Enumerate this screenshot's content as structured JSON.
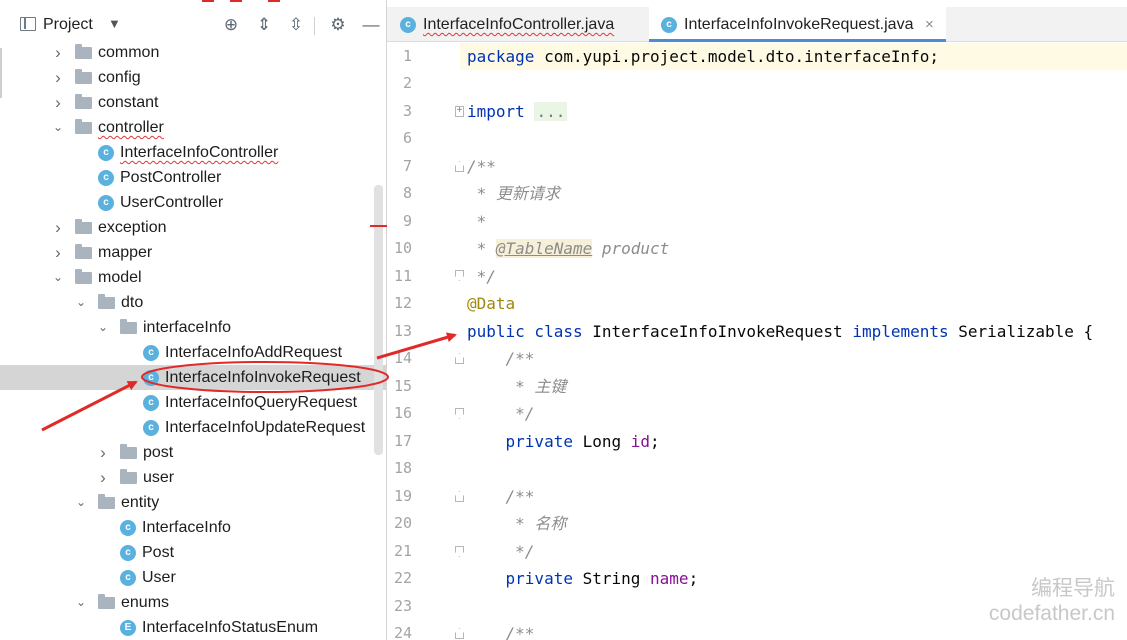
{
  "project_panel": {
    "title": "Project",
    "tree": [
      {
        "label": "common",
        "kind": "folder",
        "expanded": false,
        "squiggle": false
      },
      {
        "label": "config",
        "kind": "folder",
        "expanded": false,
        "squiggle": false
      },
      {
        "label": "constant",
        "kind": "folder",
        "expanded": false,
        "squiggle": false
      },
      {
        "label": "controller",
        "kind": "folder",
        "expanded": true,
        "squiggle": true
      },
      {
        "label": "InterfaceInfoController",
        "kind": "class",
        "squiggle": true
      },
      {
        "label": "PostController",
        "kind": "class",
        "squiggle": false
      },
      {
        "label": "UserController",
        "kind": "class",
        "squiggle": false
      },
      {
        "label": "exception",
        "kind": "folder",
        "expanded": false,
        "squiggle": false
      },
      {
        "label": "mapper",
        "kind": "folder",
        "expanded": false,
        "squiggle": false
      },
      {
        "label": "model",
        "kind": "folder",
        "expanded": true,
        "squiggle": false
      },
      {
        "label": "dto",
        "kind": "folder",
        "expanded": true,
        "squiggle": false
      },
      {
        "label": "interfaceInfo",
        "kind": "folder",
        "expanded": true,
        "squiggle": false
      },
      {
        "label": "InterfaceInfoAddRequest",
        "kind": "class",
        "squiggle": false
      },
      {
        "label": "InterfaceInfoInvokeRequest",
        "kind": "class",
        "selected": true,
        "squiggle": false
      },
      {
        "label": "InterfaceInfoQueryRequest",
        "kind": "class",
        "squiggle": false
      },
      {
        "label": "InterfaceInfoUpdateRequest",
        "kind": "class",
        "squiggle": false
      },
      {
        "label": "post",
        "kind": "folder",
        "expanded": false,
        "squiggle": false
      },
      {
        "label": "user",
        "kind": "folder",
        "expanded": false,
        "squiggle": false
      },
      {
        "label": "entity",
        "kind": "folder",
        "expanded": true,
        "squiggle": false
      },
      {
        "label": "InterfaceInfo",
        "kind": "class",
        "squiggle": false
      },
      {
        "label": "Post",
        "kind": "class",
        "squiggle": false
      },
      {
        "label": "User",
        "kind": "class",
        "squiggle": false
      },
      {
        "label": "enums",
        "kind": "folder",
        "expanded": true,
        "squiggle": false
      },
      {
        "label": "InterfaceInfoStatusEnum",
        "kind": "enum",
        "squiggle": false
      }
    ]
  },
  "editor": {
    "tabs": [
      {
        "label": "InterfaceInfoController.java",
        "active": false
      },
      {
        "label": "InterfaceInfoInvokeRequest.java",
        "active": true
      }
    ],
    "line_numbers": [
      "1",
      "2",
      "3",
      "6",
      "7",
      "8",
      "9",
      "10",
      "11",
      "12",
      "13",
      "14",
      "15",
      "16",
      "17",
      "18",
      "19",
      "20",
      "21",
      "22",
      "23",
      "24"
    ],
    "code": {
      "l1_kw": "package",
      "l1_rest": " com.yupi.project.model.dto.interfaceInfo;",
      "l3_kw": "import",
      "l3_dots": "...",
      "l7": "/**",
      "l8": " * 更新请求",
      "l9": " *",
      "l10_pre": " * ",
      "l10_tag": "@TableName",
      "l10_post": " product",
      "l11": " */",
      "l12": "@Data",
      "l13_kw1": "public class",
      "l13_name": " InterfaceInfoInvokeRequest ",
      "l13_kw2": "implements",
      "l13_rest": " Serializable {",
      "l14": "    /**",
      "l15": "     * 主键",
      "l16": "     */",
      "l17_kw": "    private",
      "l17_type": " Long ",
      "l17_field": "id",
      "l17_end": ";",
      "l19": "    /**",
      "l20": "     * 名称",
      "l21": "     */",
      "l22_kw": "    private",
      "l22_type": " String ",
      "l22_field": "name",
      "l22_end": ";",
      "l24": "    /**"
    }
  },
  "watermark": {
    "line1": "编程导航",
    "line2": "codefather.cn"
  },
  "colors": {
    "keyword": "#0033b3",
    "comment": "#8c8c8c",
    "annotation": "#9e880d",
    "field": "#871094",
    "class_icon": "#5ab1de",
    "arrow": "#e02a2a"
  }
}
